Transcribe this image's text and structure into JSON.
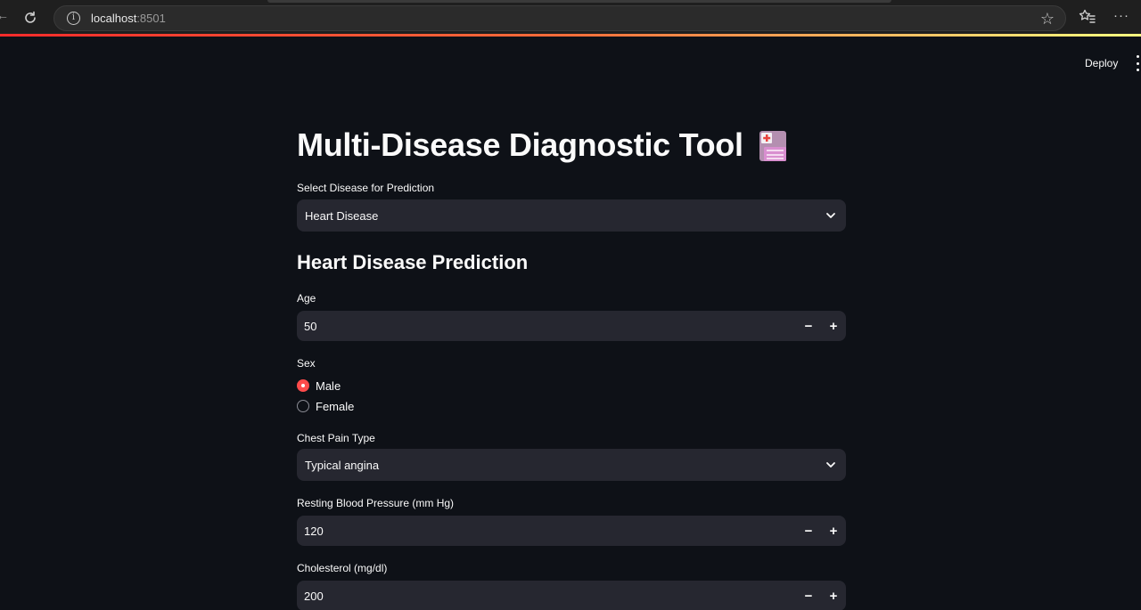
{
  "browser": {
    "url_host": "localhost",
    "url_port": ":8501"
  },
  "header": {
    "deploy_label": "Deploy"
  },
  "page": {
    "title": "Multi-Disease Diagnostic Tool",
    "title_icon": "floppy-disk-medical-emoji"
  },
  "disease_select": {
    "label": "Select Disease for Prediction",
    "value": "Heart Disease"
  },
  "section": {
    "title": "Heart Disease Prediction"
  },
  "age": {
    "label": "Age",
    "value": "50",
    "minus": "−",
    "plus": "+"
  },
  "sex": {
    "label": "Sex",
    "options": [
      "Male",
      "Female"
    ],
    "selected": "Male"
  },
  "chest_pain": {
    "label": "Chest Pain Type",
    "value": "Typical angina"
  },
  "resting_bp": {
    "label": "Resting Blood Pressure (mm Hg)",
    "value": "120",
    "minus": "−",
    "plus": "+"
  },
  "cholesterol": {
    "label": "Cholesterol (mg/dl)",
    "value": "200",
    "minus": "−",
    "plus": "+"
  },
  "colors": {
    "background": "#0e1117",
    "input_bg": "#262730",
    "accent": "#ff4b4b",
    "text": "#fafafa"
  }
}
